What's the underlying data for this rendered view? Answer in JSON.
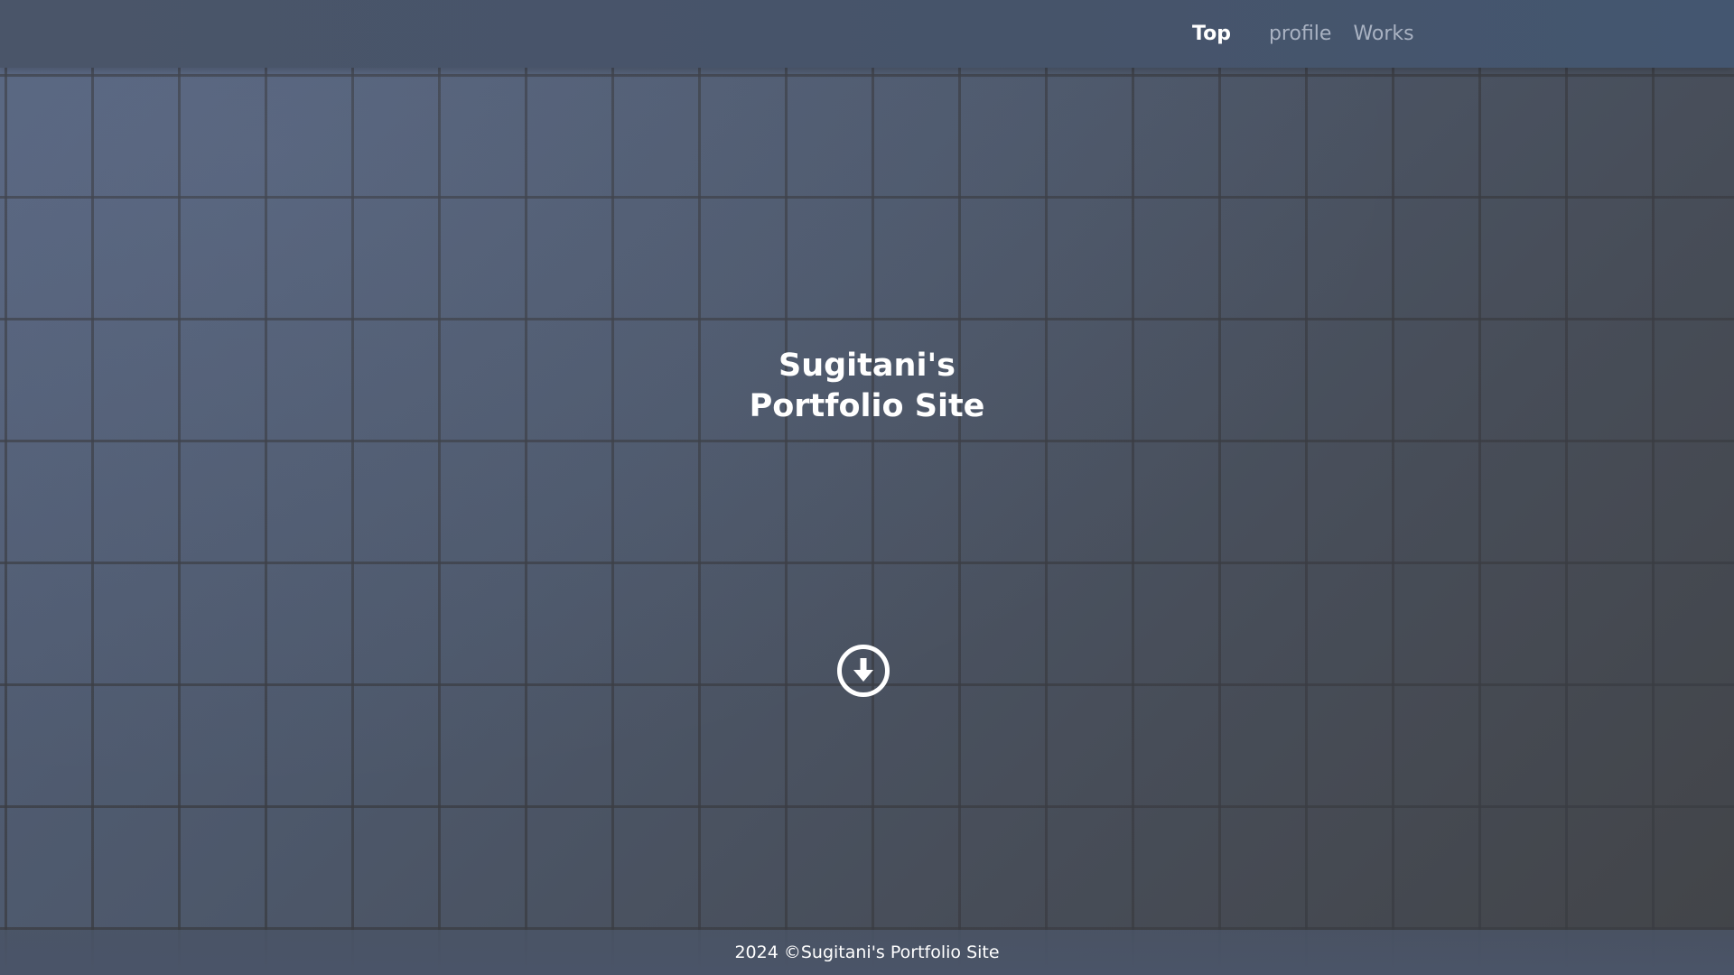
{
  "nav": {
    "items": [
      {
        "label": "Top",
        "active": true
      },
      {
        "label": "profile",
        "active": false
      },
      {
        "label": "Works",
        "active": false
      }
    ]
  },
  "hero": {
    "title": "Sugitani's\nPortfolio Site",
    "scroll_icon": "arrow-down-circle-icon"
  },
  "footer": {
    "copyright": "2024 ©Sugitani's Portfolio Site"
  },
  "colors": {
    "header_bg": "#46546a",
    "text_primary": "#ffffff",
    "nav_inactive": "#a9b2c2"
  }
}
